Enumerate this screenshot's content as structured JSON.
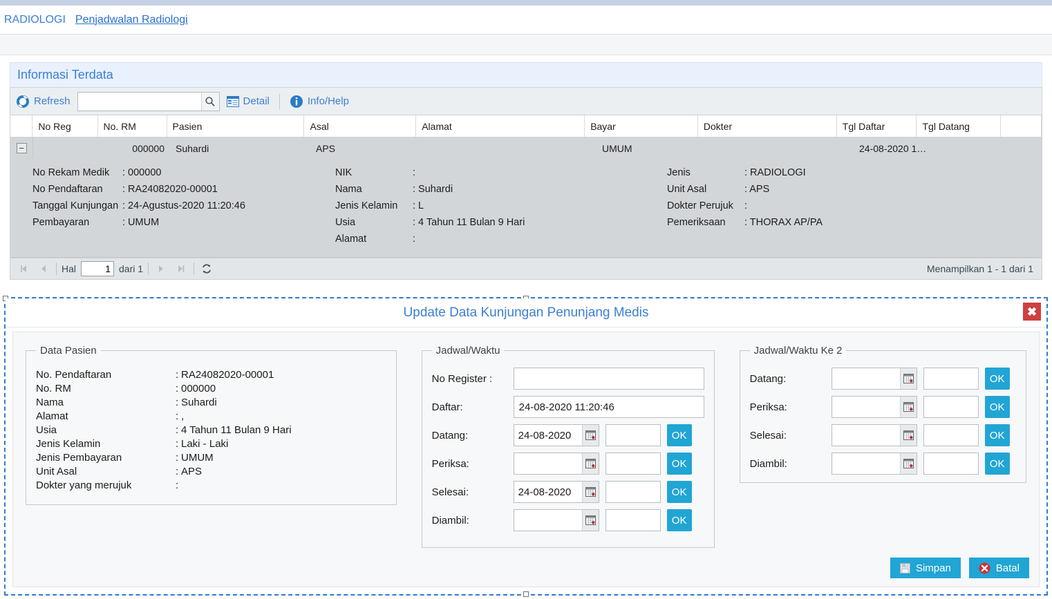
{
  "breadcrumb": {
    "root": "RADIOLOGI",
    "current": "Penjadwalan Radiologi"
  },
  "panel": {
    "title": "Informasi Terdata"
  },
  "toolbar": {
    "refresh_label": "Refresh",
    "search_value": "",
    "search_placeholder": "",
    "detail_label": "Detail",
    "info_label": "Info/Help",
    "refresh_icon": "refresh-icon",
    "search_icon": "magnifier-icon",
    "detail_icon": "detail-icon",
    "info_icon": "info-icon"
  },
  "grid": {
    "columns": [
      "No Reg",
      "No. RM",
      "Pasien",
      "Asal",
      "Alamat",
      "Bayar",
      "Dokter",
      "Tgl Daftar",
      "Tgl Datang"
    ],
    "row": {
      "no_reg": "",
      "no_rm": "000000",
      "pasien": "Suhardi",
      "asal": "APS",
      "alamat": "",
      "bayar": "UMUM",
      "dokter": "",
      "tgl_daftar": "24-08-2020 1…",
      "tgl_datang": ""
    },
    "expander_glyph": "−",
    "detail": {
      "col1": [
        {
          "label": "No Rekam Medik",
          "value": ": 000000"
        },
        {
          "label": "No Pendaftaran",
          "value": ": RA24082020-00001"
        },
        {
          "label": "Tanggal Kunjungan",
          "value": ": 24-Agustus-2020 11:20:46"
        },
        {
          "label": "Pembayaran",
          "value": ": UMUM"
        }
      ],
      "col2": [
        {
          "label": "NIK",
          "value": ":"
        },
        {
          "label": "Nama",
          "value": ": Suhardi"
        },
        {
          "label": "Jenis Kelamin",
          "value": ": L"
        },
        {
          "label": "Usia",
          "value": ": 4 Tahun 11 Bulan 9 Hari"
        },
        {
          "label": "Alamat",
          "value": ":"
        }
      ],
      "col3": [
        {
          "label": "Jenis",
          "value": ": RADIOLOGI"
        },
        {
          "label": "Unit Asal",
          "value": ": APS"
        },
        {
          "label": "Dokter Perujuk",
          "value": ":"
        },
        {
          "label": "Pemeriksaan",
          "value": ": THORAX AP/PA"
        }
      ]
    }
  },
  "pager": {
    "page_label": "Hal",
    "page_value": "1",
    "of_label": "dari 1",
    "status": "Menampilkan 1 - 1 dari 1"
  },
  "modal": {
    "title": "Update Data Kunjungan Penunjang Medis",
    "close_glyph": "✖",
    "data_pasien": {
      "legend": "Data Pasien",
      "rows": [
        {
          "label": "No. Pendaftaran",
          "value": "RA24082020-00001"
        },
        {
          "label": "No. RM",
          "value": "000000"
        },
        {
          "label": "Nama",
          "value": "Suhardi"
        },
        {
          "label": "Alamat",
          "value": ","
        },
        {
          "label": "Usia",
          "value": "4 Tahun 11 Bulan 9 Hari"
        },
        {
          "label": "Jenis Kelamin",
          "value": "Laki - Laki"
        },
        {
          "label": "Jenis Pembayaran",
          "value": "UMUM"
        },
        {
          "label": "Unit Asal",
          "value": "APS"
        },
        {
          "label": "Dokter yang merujuk",
          "value": ""
        }
      ]
    },
    "jadwal": {
      "legend": "Jadwal/Waktu",
      "no_register_label": "No Register :",
      "no_register_value": "",
      "daftar_label": "Daftar:",
      "daftar_value": "24-08-2020 11:20:46",
      "rows": [
        {
          "label": "Datang:",
          "date": "24-08-2020",
          "time": "",
          "ok": "OK"
        },
        {
          "label": "Periksa:",
          "date": "",
          "time": "",
          "ok": "OK"
        },
        {
          "label": "Selesai:",
          "date": "24-08-2020",
          "time": "",
          "ok": "OK"
        },
        {
          "label": "Diambil:",
          "date": "",
          "time": "",
          "ok": "OK"
        }
      ]
    },
    "jadwal2": {
      "legend": "Jadwal/Waktu Ke 2",
      "rows": [
        {
          "label": "Datang:",
          "date": "",
          "time": "",
          "ok": "OK"
        },
        {
          "label": "Periksa:",
          "date": "",
          "time": "",
          "ok": "OK"
        },
        {
          "label": "Selesai:",
          "date": "",
          "time": "",
          "ok": "OK"
        },
        {
          "label": "Diambil:",
          "date": "",
          "time": "",
          "ok": "OK"
        }
      ]
    },
    "footer": {
      "save_label": "Simpan",
      "cancel_label": "Batal"
    }
  },
  "colors": {
    "accent": "#21a5d4",
    "link": "#3b7fd4",
    "danger": "#cf4040",
    "row_bg": "#d3d6d9"
  }
}
